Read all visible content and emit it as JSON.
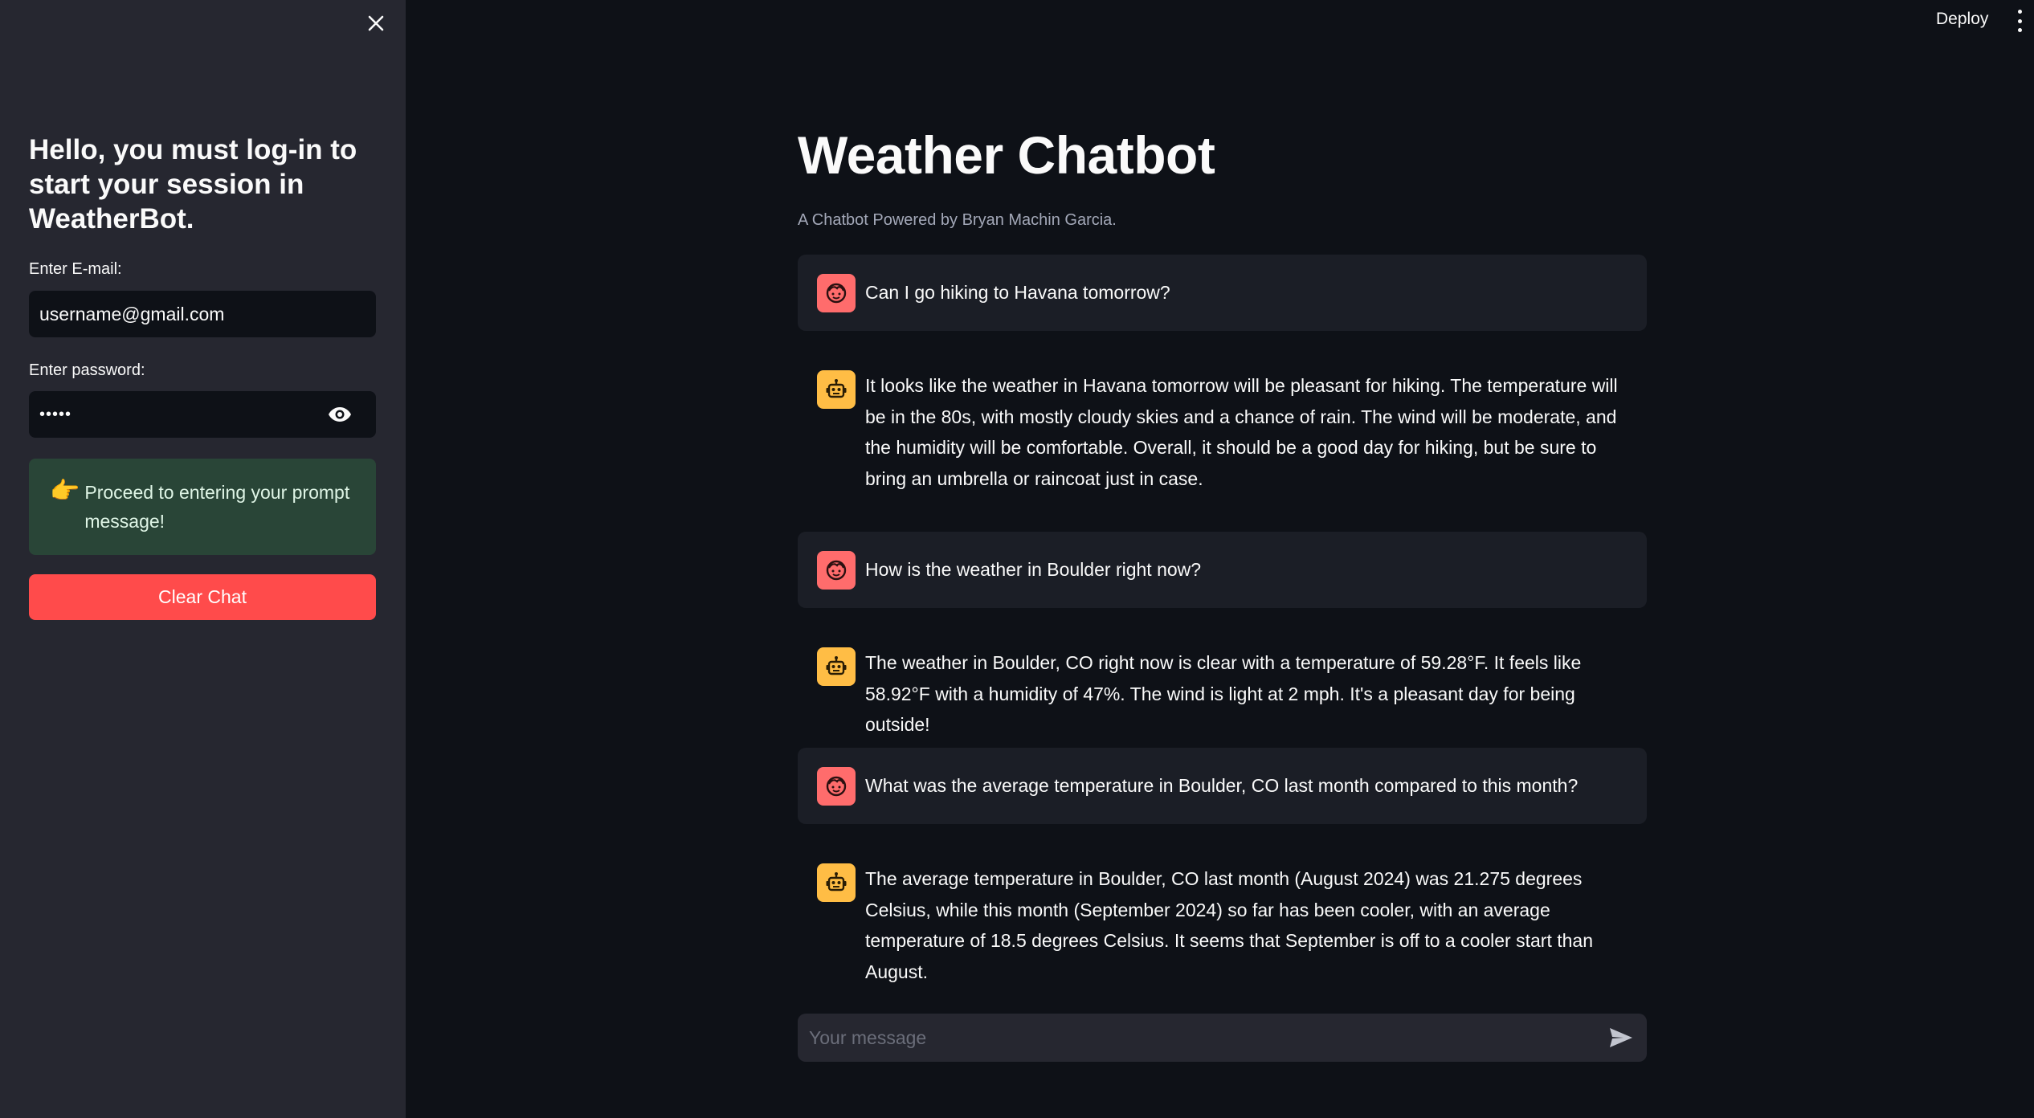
{
  "sidebar": {
    "heading": "Hello, you must log-in to start your session in WeatherBot.",
    "email_label": "Enter E-mail:",
    "email_value": "username@gmail.com",
    "password_label": "Enter password:",
    "password_value": "•••••",
    "alert_icon": "👉",
    "alert_text": "Proceed to entering your prompt message!",
    "clear_button": "Clear Chat",
    "close_icon": "close-icon"
  },
  "header": {
    "deploy_label": "Deploy",
    "menu_icon": "kebab-menu-icon"
  },
  "main": {
    "title": "Weather Chatbot",
    "subtitle": "A Chatbot Powered by Bryan Machin Garcia.",
    "messages": [
      {
        "role": "user",
        "text": "Can I go hiking to Havana tomorrow?"
      },
      {
        "role": "assistant",
        "text": "It looks like the weather in Havana tomorrow will be pleasant for hiking. The temperature will be in the 80s, with mostly cloudy skies and a chance of rain. The wind will be moderate, and the humidity will be comfortable. Overall, it should be a good day for hiking, but be sure to bring an umbrella or raincoat just in case."
      },
      {
        "role": "user",
        "text": "How is the weather in Boulder right now?"
      },
      {
        "role": "assistant",
        "text": "The weather in Boulder, CO right now is clear with a temperature of 59.28°F. It feels like 58.92°F with a humidity of 47%. The wind is light at 2 mph. It's a pleasant day for being outside!"
      },
      {
        "role": "user",
        "text": "What was the average temperature in Boulder, CO last month compared to this month?"
      },
      {
        "role": "assistant",
        "text": "The average temperature in Boulder, CO last month (August 2024) was 21.275 degrees Celsius, while this month (September 2024) so far has been cooler, with an average temperature of 18.5 degrees Celsius. It seems that September is off to a cooler start than August."
      }
    ],
    "input_placeholder": "Your message"
  },
  "colors": {
    "sidebar_bg": "#262730",
    "main_bg": "#0e1117",
    "primary_button": "#ff4b4b",
    "user_avatar": "#ff6c6c",
    "bot_avatar": "#ffbd45",
    "success_bg": "#294537"
  }
}
